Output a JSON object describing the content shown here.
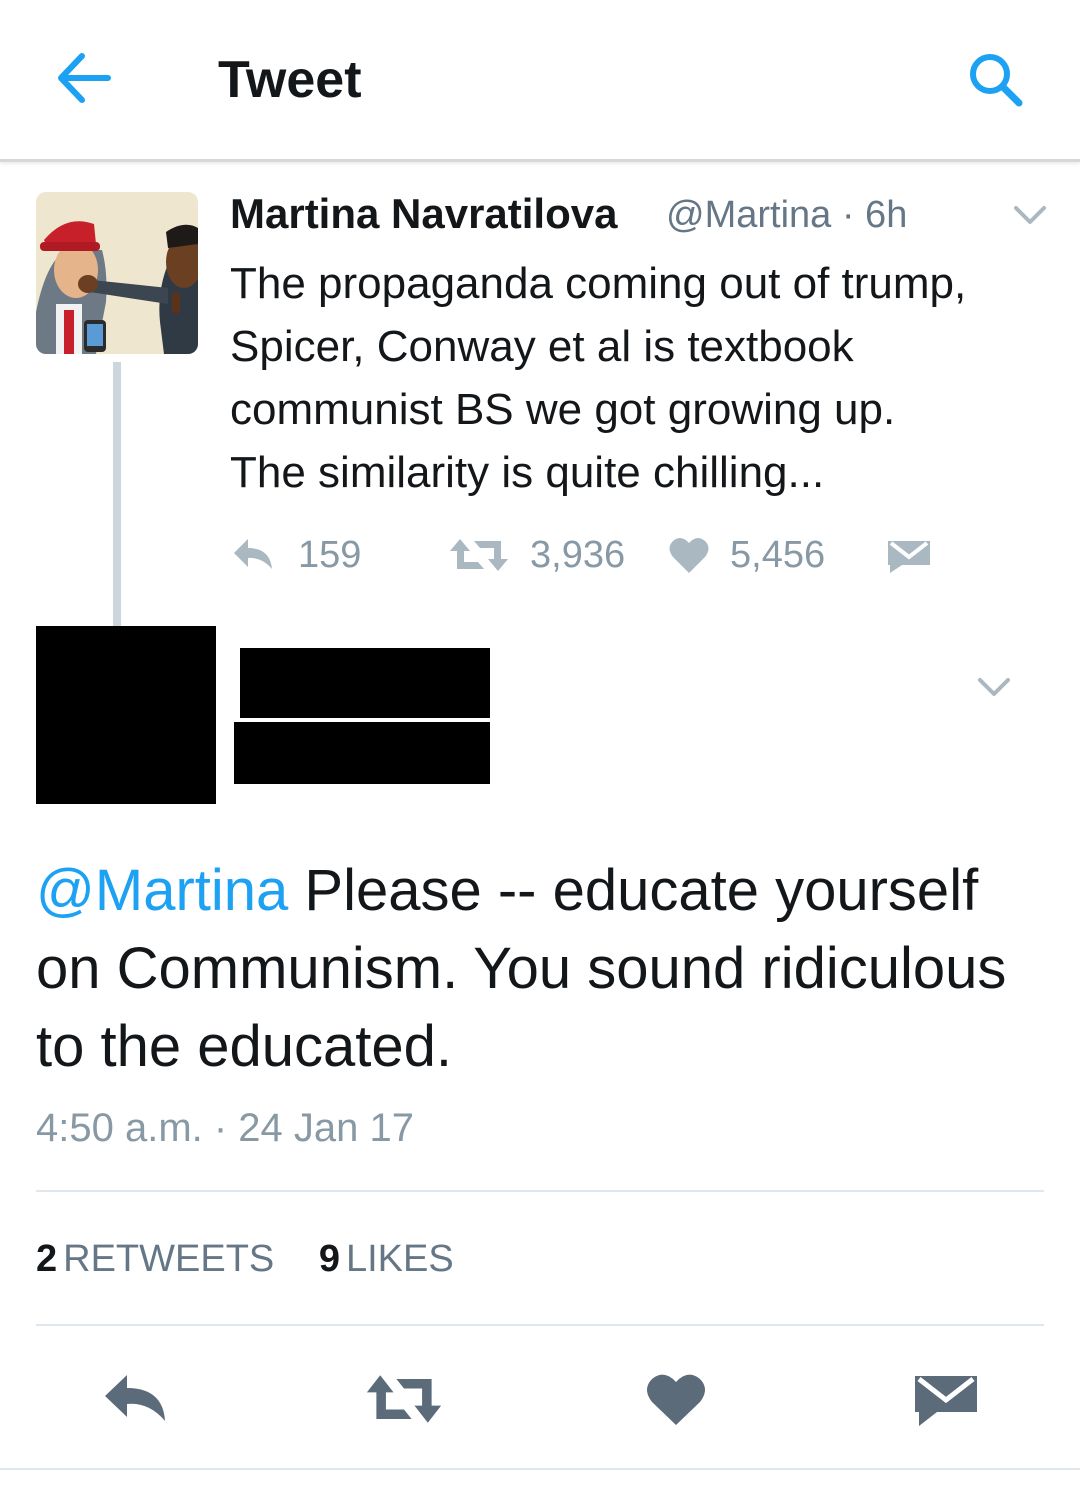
{
  "header": {
    "title": "Tweet",
    "back_icon": "back-arrow-icon",
    "search_icon": "search-icon"
  },
  "colors": {
    "accent": "#1da1f2",
    "muted": "#8899a6",
    "text": "#14171a",
    "action_icon": "#5b6b79"
  },
  "original_tweet": {
    "author_name": "Martina Navratilova",
    "author_meta": "@Martina · 6h",
    "lines": [
      "The propaganda coming out of trump,",
      "Spicer, Conway et al is textbook",
      "communist BS we got growing up.",
      "The similarity is quite chilling..."
    ],
    "reply_count": "159",
    "retweet_count": "3,936",
    "like_count": "5,456"
  },
  "reply_tweet": {
    "mention": "@Martina",
    "line1_rest": " Please -- educate yourself",
    "line2": "on Communism. You sound ridiculous",
    "line3": "to the educated.",
    "timestamp": "4:50 a.m. · 24 Jan 17",
    "retweets_count": "2",
    "retweets_label": "RETWEETS",
    "likes_count": "9",
    "likes_label": "LIKES"
  }
}
